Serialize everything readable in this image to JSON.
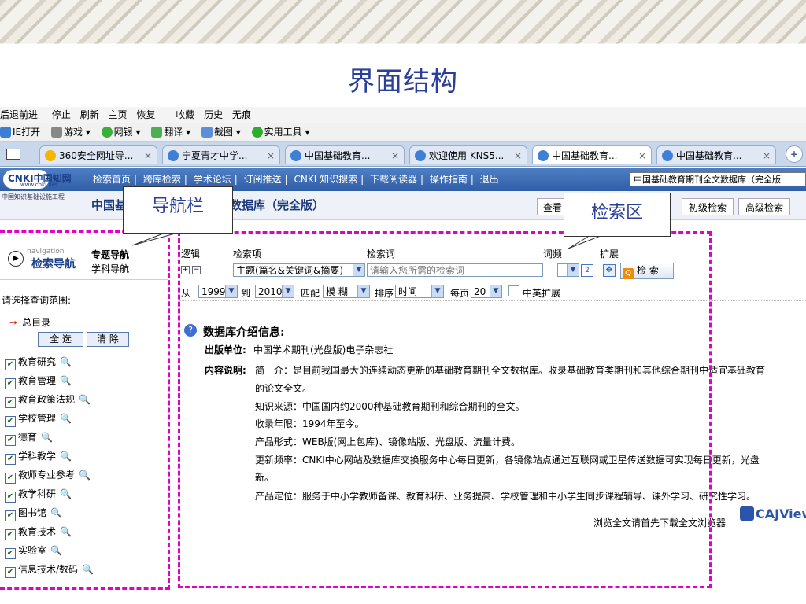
{
  "slide_title": "界面结构",
  "browser": {
    "nav_buttons": [
      "后退",
      "前进",
      "停止",
      "刷新",
      "主页",
      "恢复",
      "收藏",
      "历史",
      "无痕"
    ],
    "toolbar": [
      "IE打开",
      "游戏 ▾",
      "网银 ▾",
      "翻译 ▾",
      "截图 ▾",
      "实用工具 ▾"
    ],
    "tabs": [
      "360安全网址导...",
      "宁夏青才中学...",
      "中国基础教育...",
      "欢迎使用 KNS5...",
      "中国基础教育...",
      "中国基础教育..."
    ],
    "tab_close": "×",
    "new_tab": "+"
  },
  "cnki": {
    "logo_main": "CNKI中国知网",
    "logo_sub": "www.cnki.net",
    "org": "中国知识基础设施工程",
    "nav_links": [
      "检索首页",
      "跨库检索",
      "学术论坛",
      "订阅推送",
      "CNKI 知识搜索",
      "下载阅读器",
      "操作指南",
      "退出"
    ],
    "db_select": "中国基础教育期刊全文数据库（完全版",
    "db_title_left": "中国基",
    "db_title_right": "数据库（完全版）",
    "top_buttons": {
      "view": "查看",
      "basic": "初级检索",
      "advanced": "高级检索"
    }
  },
  "callouts": {
    "nav": "导航栏",
    "search": "检索区"
  },
  "sidebar": {
    "nav_small": "navigation",
    "nav_title": "检索导航",
    "topic_nav": "专题导航",
    "subject_nav": "学科导航",
    "scope_prompt": "请选择查询范围:",
    "root": "总目录",
    "select_all": "全 选",
    "clear": "清 除",
    "categories": [
      "教育研究",
      "教育管理",
      "教育政策法规",
      "学校管理",
      "德育",
      "学科教学",
      "教师专业参考",
      "教学科研",
      "图书馆",
      "教育技术",
      "实验室",
      "信息技术/数码"
    ]
  },
  "search": {
    "headers": {
      "logic": "逻辑",
      "field": "检索项",
      "term": "检索词",
      "freq": "词频",
      "expand": "扩展"
    },
    "field_value": "主题(篇名&关键词&摘要)",
    "term_placeholder": "请输入您所需的检索词",
    "search_button": "检 索",
    "from_label": "从",
    "from_year": "1999",
    "to_label": "到",
    "to_year": "2010",
    "match_label": "匹配",
    "match_value": "模 糊",
    "sort_label": "排序",
    "sort_value": "时间",
    "per_page_label": "每页",
    "per_page_value": "20",
    "cn_en_label": "中英扩展"
  },
  "info": {
    "heading": "数据库介绍信息:",
    "publisher_label": "出版单位:",
    "publisher": "中国学术期刊(光盘版)电子杂志社",
    "content_label": "内容说明:",
    "lines": [
      "简　介：是目前我国最大的连续动态更新的基础教育期刊全文数据库。收录基础教育类期刊和其他综合期刊中适宜基础教育",
      "的论文全文。",
      "知识来源：中国国内约2000种基础教育期刊和综合期刊的全文。",
      "收录年限：1994年至今。",
      "产品形式：WEB版(网上包库)、镜像站版、光盘版、流量计费。",
      "更新频率：CNKI中心网站及数据库交换服务中心每日更新，各镜像站点通过互联网或卫星传送数据可实现每日更新，光盘",
      "新。",
      "产品定位：服务于中小学教师备课、教育科研、业务提高、学校管理和中小学生同步课程辅导、课外学习、研究性学习。"
    ],
    "browser_note": "浏览全文请首先下载全文浏览器",
    "cajviewer": "CAJViewer"
  }
}
